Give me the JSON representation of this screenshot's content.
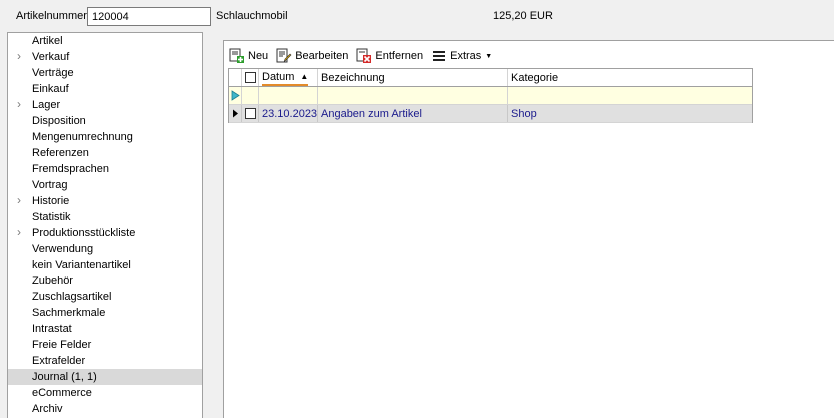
{
  "header": {
    "artikelnummer_label": "Artikelnummer",
    "artikelnummer_value": "120004",
    "artikel_name": "Schlauchmobil",
    "price": "125,20  EUR"
  },
  "nav": {
    "items": [
      {
        "label": "Artikel",
        "expandable": false
      },
      {
        "label": "Verkauf",
        "expandable": true
      },
      {
        "label": "Verträge",
        "expandable": false
      },
      {
        "label": "Einkauf",
        "expandable": false
      },
      {
        "label": "Lager",
        "expandable": true
      },
      {
        "label": "Disposition",
        "expandable": false
      },
      {
        "label": "Mengenumrechnung",
        "expandable": false
      },
      {
        "label": "Referenzen",
        "expandable": false
      },
      {
        "label": "Fremdsprachen",
        "expandable": false
      },
      {
        "label": "Vortrag",
        "expandable": false
      },
      {
        "label": "Historie",
        "expandable": true
      },
      {
        "label": "Statistik",
        "expandable": false
      },
      {
        "label": "Produktionsstückliste",
        "expandable": true
      },
      {
        "label": "Verwendung",
        "expandable": false
      },
      {
        "label": "kein Variantenartikel",
        "expandable": false
      },
      {
        "label": "Zubehör",
        "expandable": false
      },
      {
        "label": "Zuschlagsartikel",
        "expandable": false
      },
      {
        "label": "Sachmerkmale",
        "expandable": false
      },
      {
        "label": "Intrastat",
        "expandable": false
      },
      {
        "label": "Freie Felder",
        "expandable": false
      },
      {
        "label": "Extrafelder",
        "expandable": false
      },
      {
        "label": "Journal (1, 1)",
        "expandable": false,
        "selected": true
      },
      {
        "label": "eCommerce",
        "expandable": false
      },
      {
        "label": "Archiv",
        "expandable": false
      }
    ]
  },
  "toolbar": {
    "new_label": "Neu",
    "edit_label": "Bearbeiten",
    "remove_label": "Entfernen",
    "extras_label": "Extras"
  },
  "grid": {
    "columns": [
      "Datum",
      "Bezeichnung",
      "Kategorie"
    ],
    "rows": [
      {
        "datum": "23.10.2023",
        "bezeichnung": "Angaben zum Artikel",
        "kategorie": "Shop"
      }
    ]
  },
  "colors": {
    "accent_sort": "#e38b2a",
    "row_text": "#1a1a8c",
    "new_row_bg": "#ffffe1"
  }
}
